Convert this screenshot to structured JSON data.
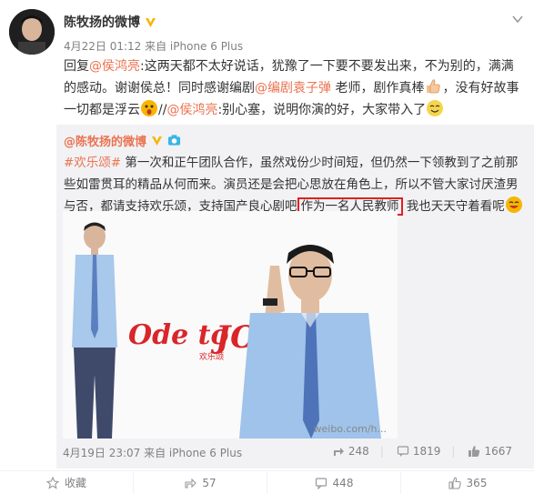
{
  "post": {
    "username": "陈牧扬的微博",
    "meta": "4月22日 01:12 来自 iPhone 6 Plus",
    "text": {
      "reply": "回复",
      "mention1": "@侯鸿亮",
      "t1": ":这两天都不太好说话，犹豫了一下要不要发出来，不为别的，满满的感动。谢谢侯总！同时感谢编剧",
      "mention2": "@编剧袁子弹",
      "t2": " 老师，剧作真棒",
      "t3": "，没有好故事一切都是浮云",
      "t4": "//",
      "mention3": "@侯鸿亮",
      "t5": ":别心塞，说明你演的好，大家带入了"
    }
  },
  "repost": {
    "username": "@陈牧扬的微博",
    "hashtag": "#欢乐颂#",
    "t1": " 第一次和正午团队合作，虽然戏份少时间短，但仍然一下领教到了之前那些如雷贯耳的精品从何而来。演员还是会把心思放在角色上，所以不管大家讨厌渣男与否，都请支持欢乐颂，支持国产良心剧吧",
    "highlight": "作为一名人民教师",
    "t2": " 我也天天守着看呢",
    "photo_logo": "Ode to JOY",
    "photo_logo_sub": "欢乐颂",
    "photo_caption": "weibo.com/h...",
    "footer_meta": "4月19日 23:07 来自 iPhone 6 Plus",
    "stats": {
      "share": "248",
      "comment": "1819",
      "like": "1667"
    }
  },
  "bottom_bar": {
    "favorite": "收藏",
    "share": "57",
    "comment": "448",
    "like": "365"
  },
  "colors": {
    "accent": "#eb7350",
    "highlight_box": "#e02020",
    "repost_bg": "#f2f2f5"
  }
}
